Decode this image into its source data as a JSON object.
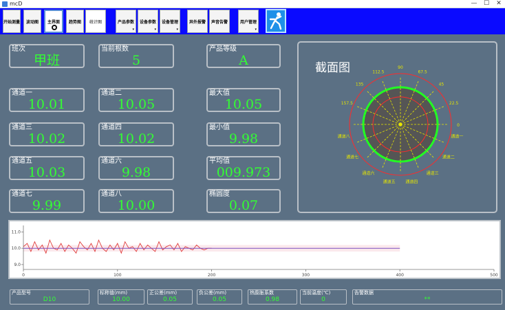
{
  "window": {
    "title": "mcD",
    "minimize": "—",
    "maximize": "☐",
    "close": "✕"
  },
  "toolbar": {
    "buttons": [
      {
        "label": "开始测量",
        "dropdown": false,
        "selected": false,
        "plain": false
      },
      {
        "label": "波动图",
        "dropdown": false,
        "selected": false,
        "plain": false
      },
      {
        "label": "主界面",
        "dropdown": false,
        "selected": true,
        "plain": false
      },
      {
        "label": "趋势图",
        "dropdown": false,
        "selected": false,
        "plain": false
      },
      {
        "label": "统计图",
        "dropdown": false,
        "selected": false,
        "plain": true
      },
      {
        "label": "产品参数",
        "dropdown": true,
        "selected": false,
        "plain": false
      },
      {
        "label": "设备参数",
        "dropdown": true,
        "selected": false,
        "plain": false
      },
      {
        "label": "设备管理",
        "dropdown": true,
        "selected": false,
        "plain": false
      },
      {
        "label": "异外报警",
        "dropdown": false,
        "selected": false,
        "plain": false
      },
      {
        "label": "声音告警",
        "dropdown": false,
        "selected": false,
        "plain": false
      },
      {
        "label": "用户管理",
        "dropdown": true,
        "selected": false,
        "plain": false
      }
    ]
  },
  "fields": {
    "shift": {
      "label": "班次",
      "value": "甲班"
    },
    "current_count": {
      "label": "当前根数",
      "value": "5"
    },
    "grade": {
      "label": "产品等级",
      "value": "A"
    },
    "ch1": {
      "label": "通道一",
      "value": "10.01"
    },
    "ch2": {
      "label": "通道二",
      "value": "10.05"
    },
    "max": {
      "label": "最大值",
      "value": "10.05"
    },
    "ch3": {
      "label": "通道三",
      "value": "10.02"
    },
    "ch4": {
      "label": "通道四",
      "value": "10.02"
    },
    "min": {
      "label": "最小值",
      "value": "9.98"
    },
    "ch5": {
      "label": "通道五",
      "value": "10.03"
    },
    "ch6": {
      "label": "通道六",
      "value": "9.98"
    },
    "avg": {
      "label": "平均值",
      "value": "009.973"
    },
    "ch7": {
      "label": "通道七",
      "value": "9.99"
    },
    "ch8": {
      "label": "通道八",
      "value": "10.00"
    },
    "ovality": {
      "label": "椭圆度",
      "value": "0.07"
    }
  },
  "section": {
    "title": "截面图",
    "angles": [
      "90",
      "112.5",
      "135",
      "157.5",
      "67.5",
      "45",
      "22.5",
      "0"
    ],
    "channels": [
      "通道一",
      "通道二",
      "通道三",
      "通道四",
      "通道五",
      "通道六",
      "通道七",
      "通道八"
    ]
  },
  "chart_data": {
    "type": "line",
    "x": [
      0,
      4,
      8,
      12,
      16,
      20,
      24,
      28,
      32,
      36,
      40,
      44,
      48,
      52,
      56,
      60,
      64,
      68,
      72,
      76,
      80,
      84,
      88,
      92,
      96,
      100,
      104,
      108,
      112,
      116,
      120,
      124,
      128,
      132,
      136,
      140,
      144,
      148,
      152,
      156,
      160,
      164,
      168,
      172,
      176,
      180,
      184,
      188,
      192,
      196,
      200
    ],
    "series": [
      {
        "values": [
          10.1,
          10.3,
          9.8,
          10.4,
          9.9,
          10.2,
          9.7,
          10.5,
          10.0,
          9.9,
          10.3,
          9.8,
          10.2,
          10.0,
          9.7,
          10.4,
          10.1,
          9.9,
          10.3,
          9.8,
          10.5,
          10.0,
          9.8,
          10.2,
          9.9,
          10.3,
          9.7,
          10.4,
          10.0,
          10.1,
          9.8,
          10.3,
          9.9,
          10.2,
          10.0,
          9.8,
          10.4,
          9.9,
          10.1,
          10.2,
          9.9,
          10.3,
          9.8,
          10.1,
          10.0,
          9.9,
          10.2,
          10.0,
          9.9,
          10.0,
          10.0
        ],
        "color": "#e03c3c"
      },
      {
        "values": [
          10.0,
          10.0
        ],
        "x": [
          0,
          400
        ],
        "color": "#7a4fc0"
      }
    ],
    "xlim": [
      0,
      500
    ],
    "ylim": [
      8.7,
      11.4
    ],
    "xticks": [
      "0",
      "100",
      "200",
      "300",
      "400",
      "500"
    ],
    "yticks": [
      "11.0",
      "10.0",
      "9.0"
    ],
    "band": [
      9.8,
      10.2
    ]
  },
  "bottom": {
    "model": {
      "label": "产品型号",
      "value": "D10"
    },
    "nominal": {
      "label": "标称值(mm)",
      "value": "10.00"
    },
    "pos_tol": {
      "label": "正公差(mm)",
      "value": "0.05"
    },
    "neg_tol": {
      "label": "负公差(mm)",
      "value": "0.05"
    },
    "thermal": {
      "label": "热膨胀系数",
      "value": "0.98"
    },
    "temp": {
      "label": "当前温度(℃)",
      "value": "0"
    },
    "alarm": {
      "label": "告警数据",
      "value": "**"
    }
  }
}
